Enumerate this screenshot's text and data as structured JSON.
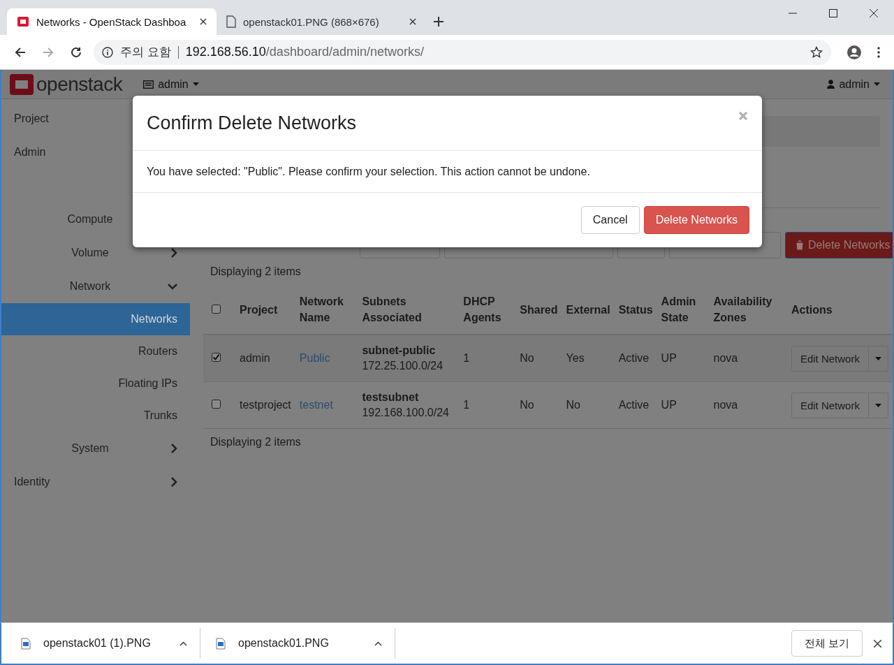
{
  "browser": {
    "tabs": [
      {
        "title": "Networks - OpenStack Dashboa",
        "kind": "site",
        "selected": true
      },
      {
        "title": "openstack01.PNG (868×676)",
        "kind": "file",
        "selected": false
      }
    ],
    "address": {
      "warning": "주의 요함",
      "host": "192.168.56.10",
      "path": "/dashboard/admin/networks/"
    }
  },
  "navbar": {
    "brand": "openstack",
    "project_menu": "admin",
    "user_menu": "admin"
  },
  "sidebar": {
    "items": [
      {
        "label": "Project"
      },
      {
        "label": "Admin",
        "children": [
          {
            "label": "Compute"
          },
          {
            "label": "Volume",
            "expanded": false
          },
          {
            "label": "Network",
            "expanded": true,
            "children": [
              {
                "label": "Networks",
                "selected": true
              },
              {
                "label": "Routers",
                "selected": false
              },
              {
                "label": "Floating IPs",
                "selected": false
              },
              {
                "label": "Trunks",
                "selected": false
              }
            ]
          },
          {
            "label": "System",
            "expanded": false
          }
        ]
      },
      {
        "label": "Identity",
        "expanded": false
      }
    ]
  },
  "toolbar": {
    "delete_button": "Delete Networks"
  },
  "table": {
    "count_top": "Displaying 2 items",
    "select_all_checked": false,
    "columns": [
      "Project",
      "Network Name",
      "Subnets Associated",
      "DHCP Agents",
      "Shared",
      "External",
      "Status",
      "Admin State",
      "Availability Zones",
      "Actions"
    ],
    "rows": [
      {
        "checked": true,
        "project": "admin",
        "network_name": "Public",
        "subnet_name": "subnet-public",
        "subnet_cidr": "172.25.100.0/24",
        "dhcp_agents": "1",
        "shared": "No",
        "external": "Yes",
        "status": "Active",
        "admin_state": "UP",
        "zones": "nova",
        "action": "Edit Network"
      },
      {
        "checked": false,
        "project": "testproject",
        "network_name": "testnet",
        "subnet_name": "testsubnet",
        "subnet_cidr": "192.168.100.0/24",
        "dhcp_agents": "1",
        "shared": "No",
        "external": "No",
        "status": "Active",
        "admin_state": "UP",
        "zones": "nova",
        "action": "Edit Network"
      }
    ],
    "count_bottom": "Displaying 2 items"
  },
  "dialog": {
    "title": "Confirm Delete Networks",
    "message": "You have selected: \"Public\". Please confirm your selection. This action cannot be undone.",
    "cancel": "Cancel",
    "confirm": "Delete Networks"
  },
  "downloads": {
    "items": [
      {
        "name": "openstack01 (1).PNG"
      },
      {
        "name": "openstack01.PNG"
      }
    ],
    "show_all": "전체 보기"
  }
}
